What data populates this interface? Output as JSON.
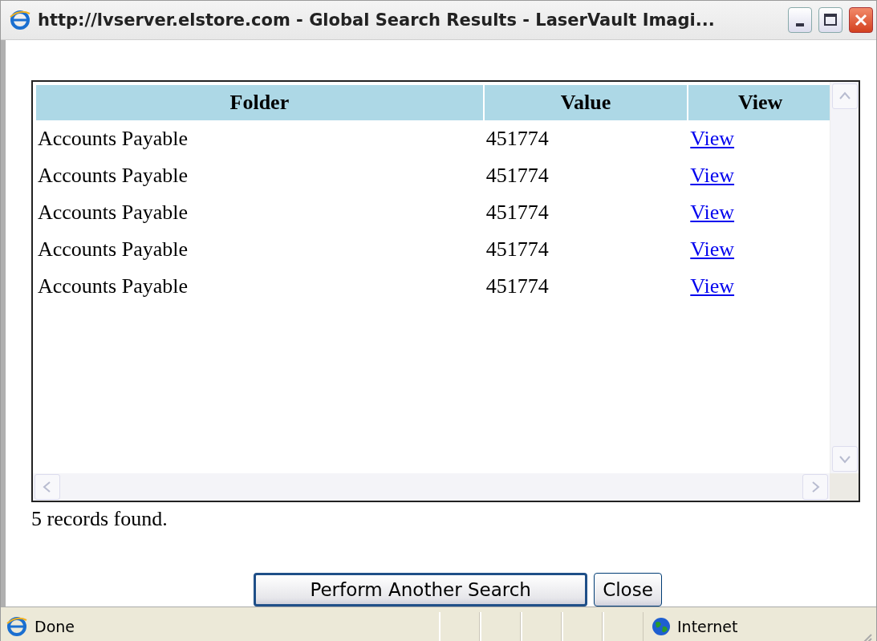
{
  "window": {
    "title": "http://lvserver.elstore.com - Global Search Results - LaserVault Imagi..."
  },
  "table": {
    "columns": [
      "Folder",
      "Value",
      "View"
    ],
    "rows": [
      {
        "folder": "Accounts Payable",
        "value": "451774",
        "link": "View"
      },
      {
        "folder": "Accounts Payable",
        "value": "451774",
        "link": "View"
      },
      {
        "folder": "Accounts Payable",
        "value": "451774",
        "link": "View"
      },
      {
        "folder": "Accounts Payable",
        "value": "451774",
        "link": "View"
      },
      {
        "folder": "Accounts Payable",
        "value": "451774",
        "link": "View"
      }
    ]
  },
  "summary": "5 records found.",
  "buttons": [
    {
      "label": "Perform Another Search",
      "default": true
    },
    {
      "label": "Close",
      "default": false
    }
  ],
  "status_bar": {
    "status": "Done",
    "zone": "Internet"
  }
}
